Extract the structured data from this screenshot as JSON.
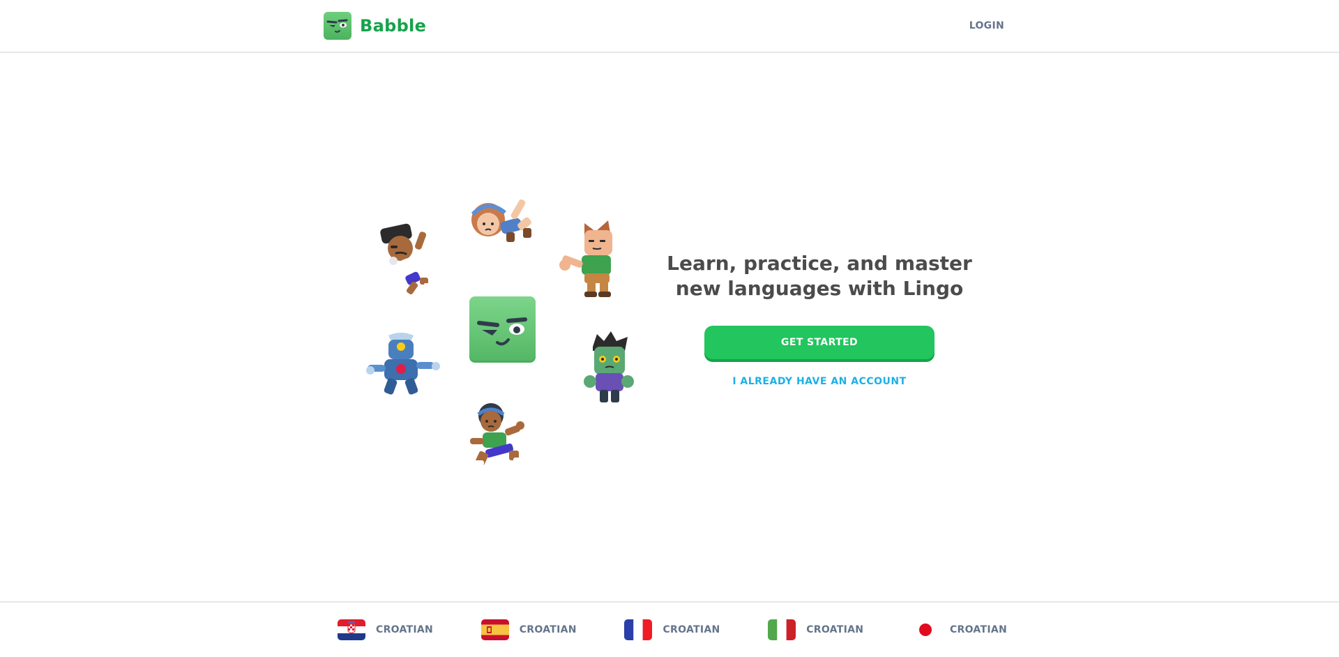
{
  "header": {
    "brand_name": "Babble",
    "login_label": "LOGIN",
    "logo_icon": "mascot-face-icon"
  },
  "hero": {
    "title": "Learn, practice, and master new languages with Lingo",
    "get_started_label": "GET STARTED",
    "have_account_label": "I ALREADY HAVE AN ACCOUNT",
    "characters": [
      "girl-character",
      "boy-character",
      "man-character",
      "robot-character",
      "zombie-character",
      "runner-character"
    ]
  },
  "footer": {
    "languages": [
      {
        "label": "CROATIAN",
        "flag": "croatia-flag-icon"
      },
      {
        "label": "CROATIAN",
        "flag": "spain-flag-icon"
      },
      {
        "label": "CROATIAN",
        "flag": "france-flag-icon"
      },
      {
        "label": "CROATIAN",
        "flag": "italy-flag-icon"
      },
      {
        "label": "CROATIAN",
        "flag": "japan-flag-icon"
      }
    ]
  },
  "colors": {
    "brand_green": "#16a34a",
    "button_green": "#22c55e",
    "link_blue": "#1cb0e6",
    "muted_text": "#64748b",
    "title_text": "#4b4b4b"
  }
}
